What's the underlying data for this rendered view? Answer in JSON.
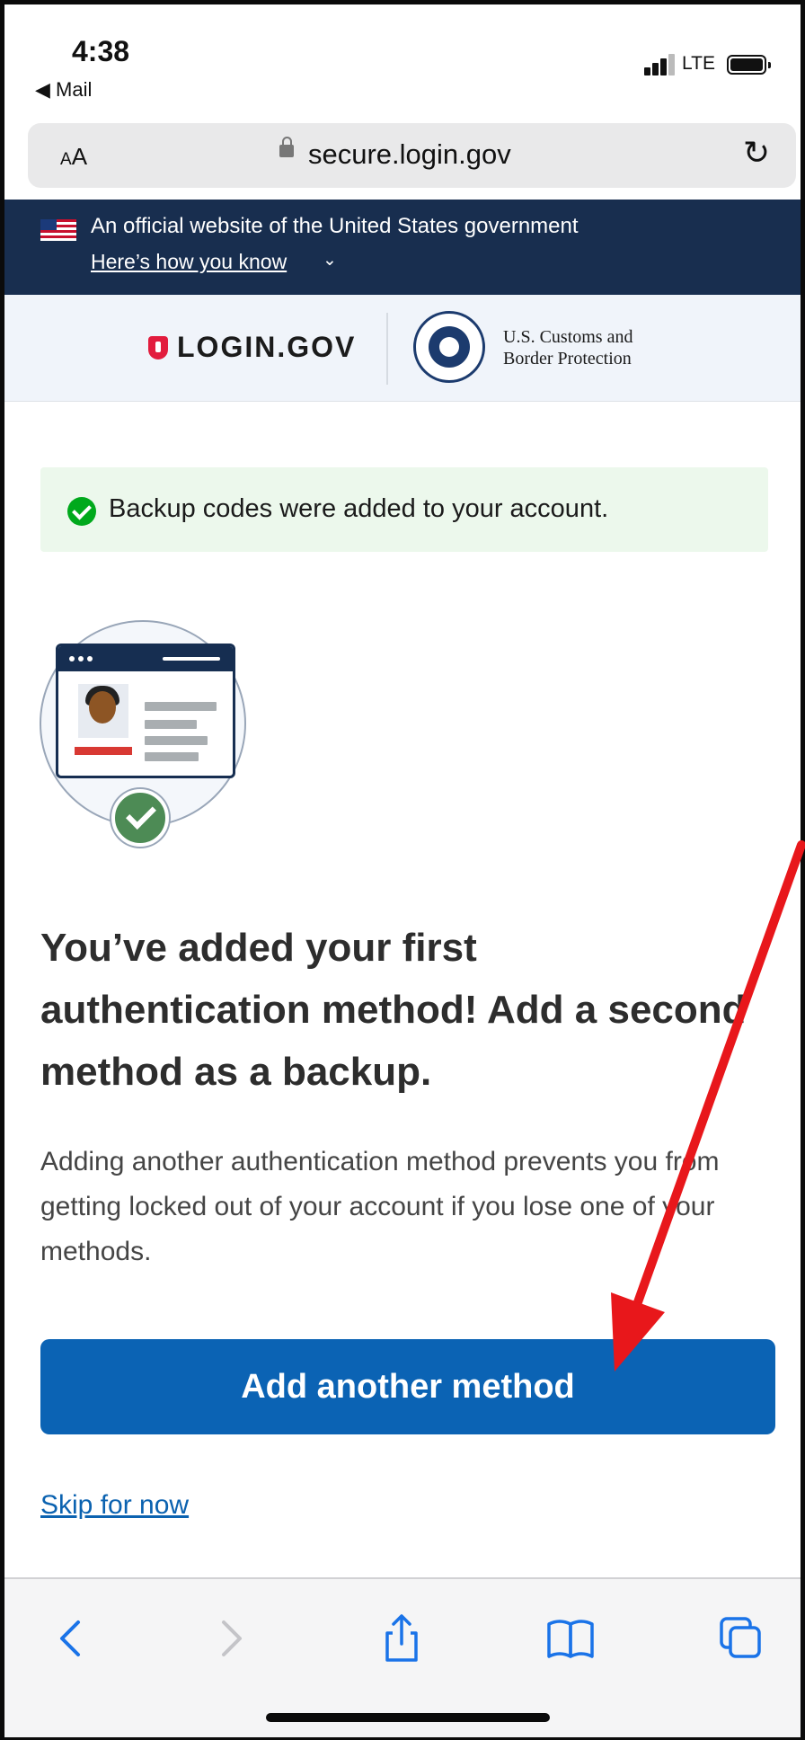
{
  "status_bar": {
    "time": "4:38",
    "back_app": "◀ Mail",
    "network": "LTE"
  },
  "url_bar": {
    "text_size_button": "AA",
    "domain": "secure.login.gov",
    "reload_icon": "reload-icon"
  },
  "gov_banner": {
    "line": "An official website of the United States government",
    "link": "Here’s how you know"
  },
  "logos": {
    "brand": "LOGIN.GOV",
    "partner_line1": "U.S. Customs and",
    "partner_line2": "Border Protection"
  },
  "alert": {
    "type": "success",
    "message": "Backup codes were added to your account."
  },
  "main": {
    "heading": "You’ve added your first authentication method! Add a second method as a backup.",
    "body": "Adding another authentication method prevents you from getting locked out of your account if you lose one of your methods.",
    "primary_button": "Add another method",
    "skip_link": "Skip for now"
  },
  "toolbar": {
    "items": [
      "back-icon",
      "forward-icon",
      "share-icon",
      "bookmarks-icon",
      "tabs-icon"
    ]
  },
  "colors": {
    "primary": "#0b63b4",
    "banner": "#182e4f",
    "success": "#00a91c",
    "annotation": "#e8171b"
  }
}
